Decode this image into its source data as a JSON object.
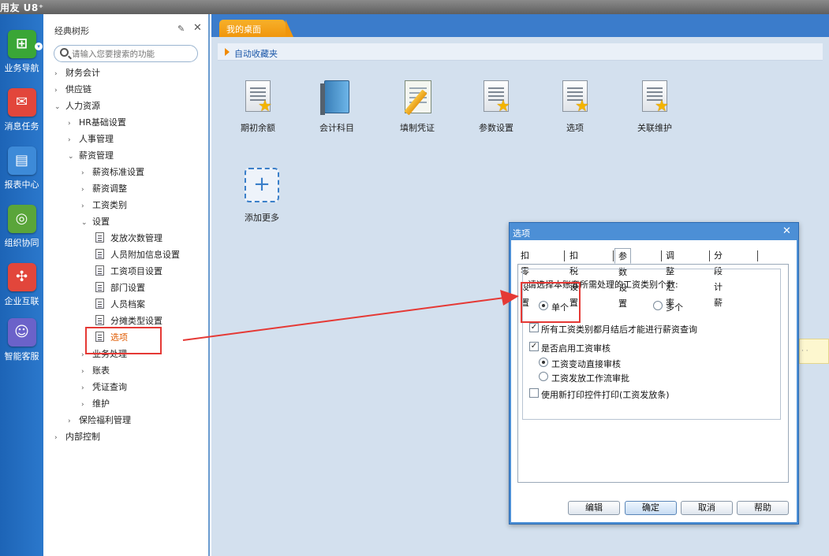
{
  "app": {
    "logo": "用友 U8⁺"
  },
  "rail": {
    "items": [
      {
        "label": "业务导航",
        "icon": "business-nav-icon",
        "color": "#3aa636"
      },
      {
        "label": "消息任务",
        "icon": "message-task-icon",
        "color": "#e2463b"
      },
      {
        "label": "报表中心",
        "icon": "report-center-icon",
        "color": "#3d8ad8"
      },
      {
        "label": "组织协同",
        "icon": "org-collab-icon",
        "color": "#5aa53a"
      },
      {
        "label": "企业互联",
        "icon": "enterprise-link-icon",
        "color": "#e2463b"
      },
      {
        "label": "智能客服",
        "icon": "smart-service-icon",
        "color": "#6b62c9"
      }
    ]
  },
  "tree": {
    "title": "经典树形",
    "search_placeholder": "请输入您要搜索的功能",
    "rows": [
      {
        "label": "财务会计",
        "arrow": "›"
      },
      {
        "label": "供应链",
        "arrow": "›"
      },
      {
        "label": "人力资源",
        "arrow": "⌄"
      },
      {
        "label": "HR基础设置",
        "arrow": "›"
      },
      {
        "label": "人事管理",
        "arrow": "›"
      },
      {
        "label": "薪资管理",
        "arrow": "⌄"
      },
      {
        "label": "薪资标准设置",
        "arrow": "›"
      },
      {
        "label": "薪资调整",
        "arrow": "›"
      },
      {
        "label": "工资类别",
        "arrow": "›"
      },
      {
        "label": "设置",
        "arrow": "⌄"
      },
      {
        "label": "发放次数管理"
      },
      {
        "label": "人员附加信息设置"
      },
      {
        "label": "工资项目设置"
      },
      {
        "label": "部门设置"
      },
      {
        "label": "人员档案"
      },
      {
        "label": "分摊类型设置"
      },
      {
        "label": "选项"
      },
      {
        "label": "业务处理",
        "arrow": "›"
      },
      {
        "label": "账表",
        "arrow": "›"
      },
      {
        "label": "凭证查询",
        "arrow": "›"
      },
      {
        "label": "维护",
        "arrow": "›"
      },
      {
        "label": "保险福利管理",
        "arrow": "›"
      },
      {
        "label": "内部控制",
        "arrow": "›"
      }
    ]
  },
  "workspace": {
    "tab": "我的桌面",
    "favorites_label": "自动收藏夹",
    "shortcuts": [
      {
        "label": "期初余额",
        "icon": "doc-star-icon"
      },
      {
        "label": "会计科目",
        "icon": "book-icon"
      },
      {
        "label": "填制凭证",
        "icon": "notebook-pencil-icon"
      },
      {
        "label": "参数设置",
        "icon": "doc-star-icon"
      },
      {
        "label": "选项",
        "icon": "doc-star-icon"
      },
      {
        "label": "关联维护",
        "icon": "doc-star-icon"
      }
    ],
    "add_more": "添加更多",
    "sticky_text": "· ·"
  },
  "dialog": {
    "title": "选项",
    "tabs": [
      "扣零设置",
      "扣税设置",
      "参数设置",
      "调整汇率",
      "分段计薪"
    ],
    "active_tab": "参数设置",
    "question": "请选择本账套所需处理的工资类别个数:",
    "radio_single": "单个",
    "radio_multi": "多个",
    "check_1": "所有工资类别都月结后才能进行薪资查询",
    "check_2": "是否启用工资审核",
    "radio_direct": "工资变动直接审核",
    "radio_flow": "工资发放工作流审批",
    "check_3": "使用新打印控件打印(工资发放条)",
    "buttons": {
      "edit": "编辑",
      "ok": "确定",
      "cancel": "取消",
      "help": "帮助"
    }
  },
  "annotation_color": "#e53935"
}
